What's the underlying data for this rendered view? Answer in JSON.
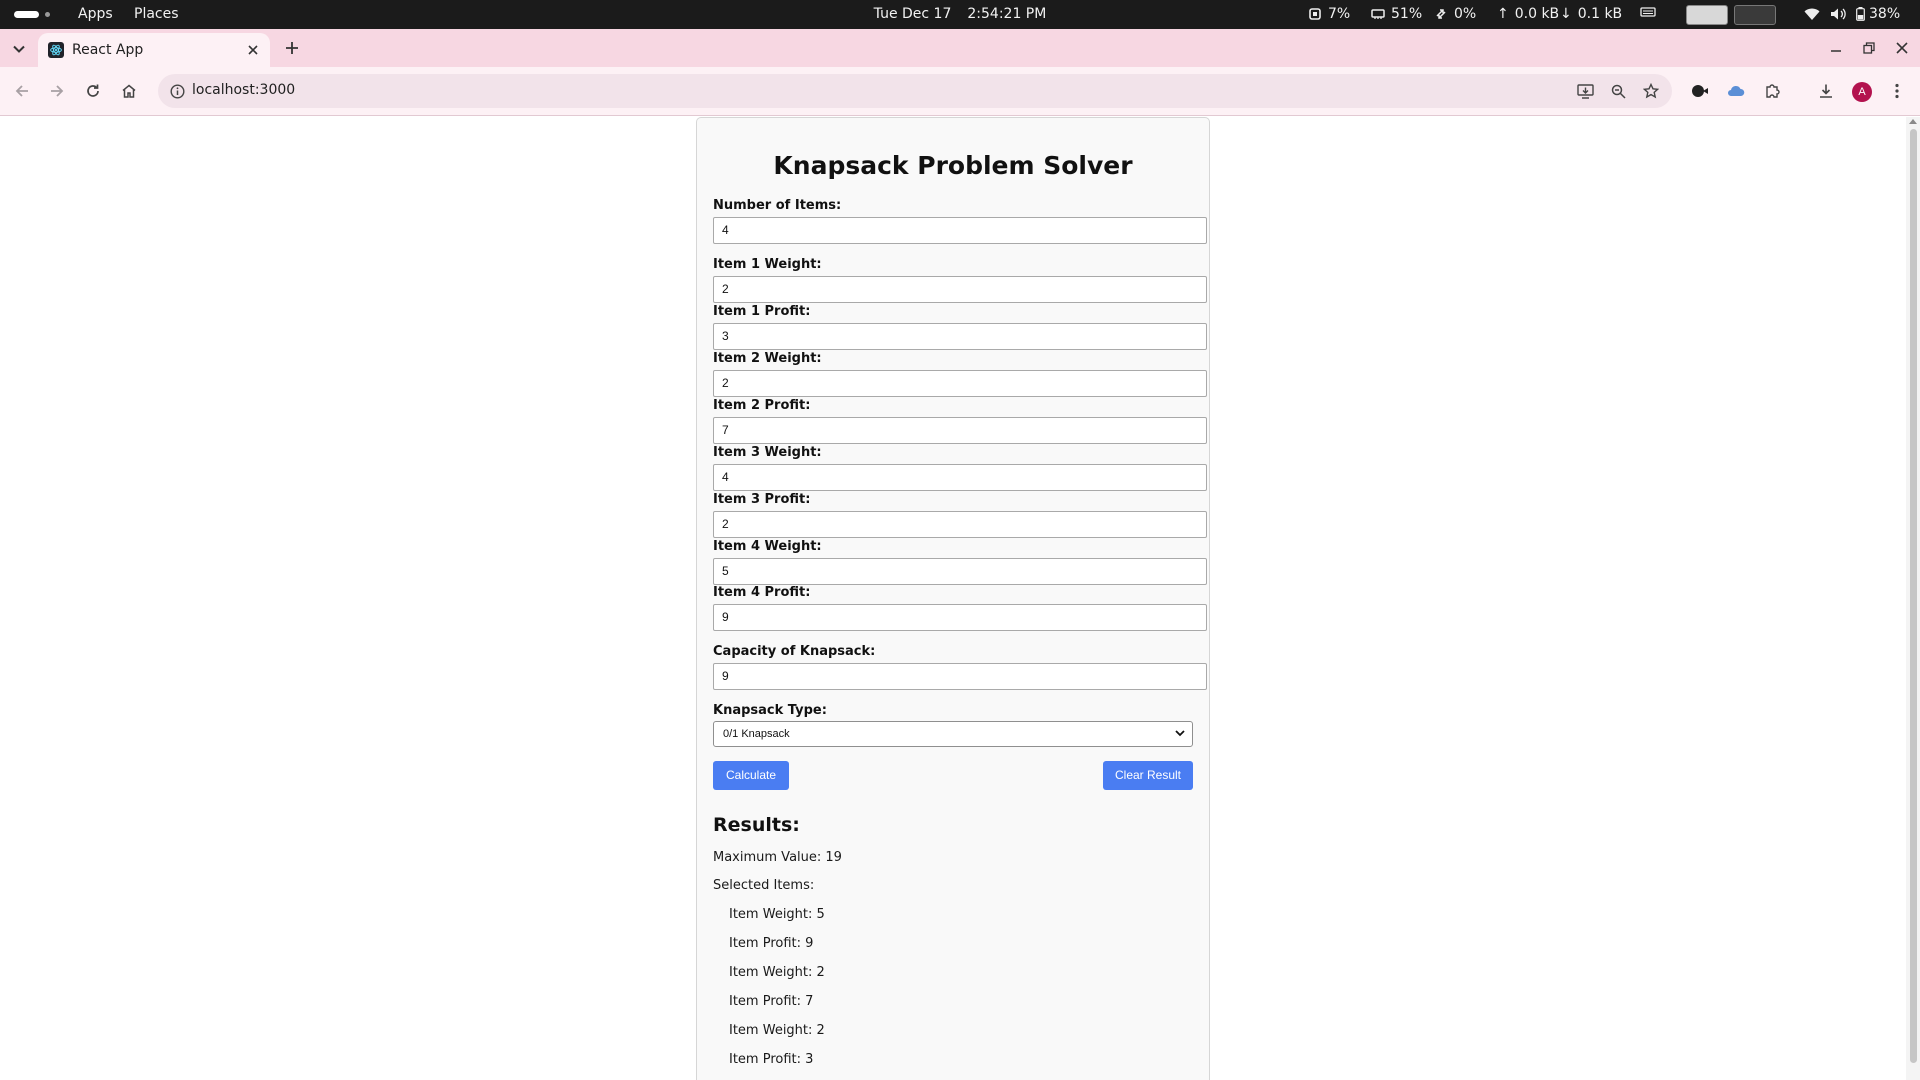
{
  "system_bar": {
    "apps_label": "Apps",
    "places_label": "Places",
    "date": "Tue Dec 17",
    "time": "2:54:21 PM",
    "cpu": "7%",
    "memory": "51%",
    "swap": "0%",
    "net_up": "0.0 kB",
    "net_down": "0.1 kB",
    "battery": "38%"
  },
  "browser": {
    "tab_title": "React App",
    "url": "localhost:3000",
    "profile_initial": "A"
  },
  "app": {
    "title": "Knapsack Problem Solver",
    "num_items_label": "Number of Items:",
    "num_items_value": "4",
    "items": [
      {
        "weight_label": "Item 1 Weight:",
        "weight": "2",
        "profit_label": "Item 1 Profit:",
        "profit": "3"
      },
      {
        "weight_label": "Item 2 Weight:",
        "weight": "2",
        "profit_label": "Item 2 Profit:",
        "profit": "7"
      },
      {
        "weight_label": "Item 3 Weight:",
        "weight": "4",
        "profit_label": "Item 3 Profit:",
        "profit": "2"
      },
      {
        "weight_label": "Item 4 Weight:",
        "weight": "5",
        "profit_label": "Item 4 Profit:",
        "profit": "9"
      }
    ],
    "capacity_label": "Capacity of Knapsack:",
    "capacity_value": "9",
    "type_label": "Knapsack Type:",
    "type_selected": "0/1 Knapsack",
    "calculate_label": "Calculate",
    "clear_label": "Clear Result",
    "results_heading": "Results:",
    "max_value_text": "Maximum Value: 19",
    "selected_items_label": "Selected Items:",
    "selected_lines": [
      "Item Weight: 5",
      "Item Profit: 9",
      "Item Weight: 2",
      "Item Profit: 7",
      "Item Weight: 2",
      "Item Profit: 3"
    ]
  }
}
